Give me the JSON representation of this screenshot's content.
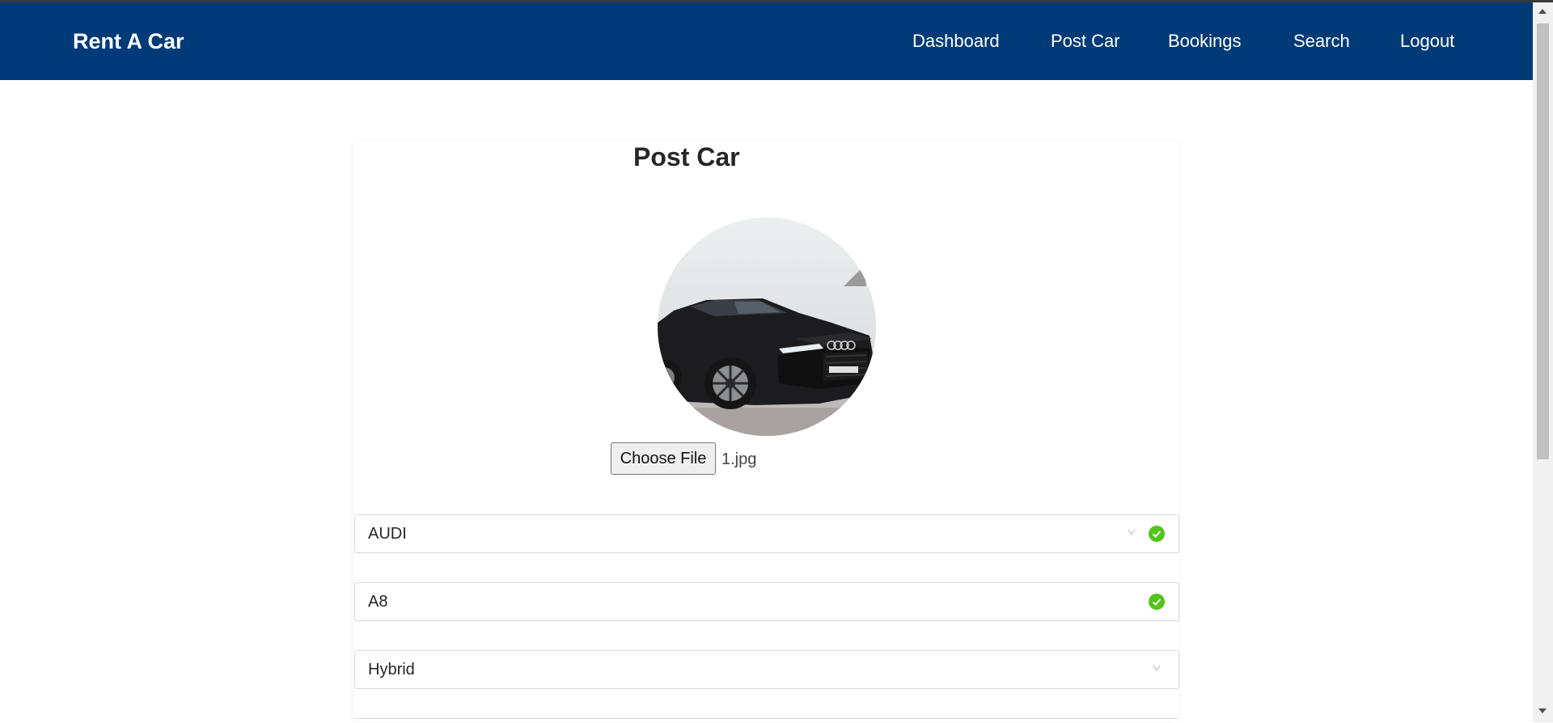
{
  "header": {
    "brand": "Rent A Car",
    "nav": [
      "Dashboard",
      "Post Car",
      "Bookings",
      "Search",
      "Logout"
    ]
  },
  "form": {
    "title": "Post Car",
    "upload": {
      "button_label": "Choose File",
      "file_name": "1.jpg"
    },
    "brand_select": {
      "value": "AUDI"
    },
    "name_input": {
      "value": "A8"
    },
    "transmission_select": {
      "value": "Hybrid"
    }
  },
  "colors": {
    "navbar": "#003b78",
    "success": "#52c41a"
  },
  "icons": [
    "chevron-down-icon",
    "check-circle-icon"
  ]
}
